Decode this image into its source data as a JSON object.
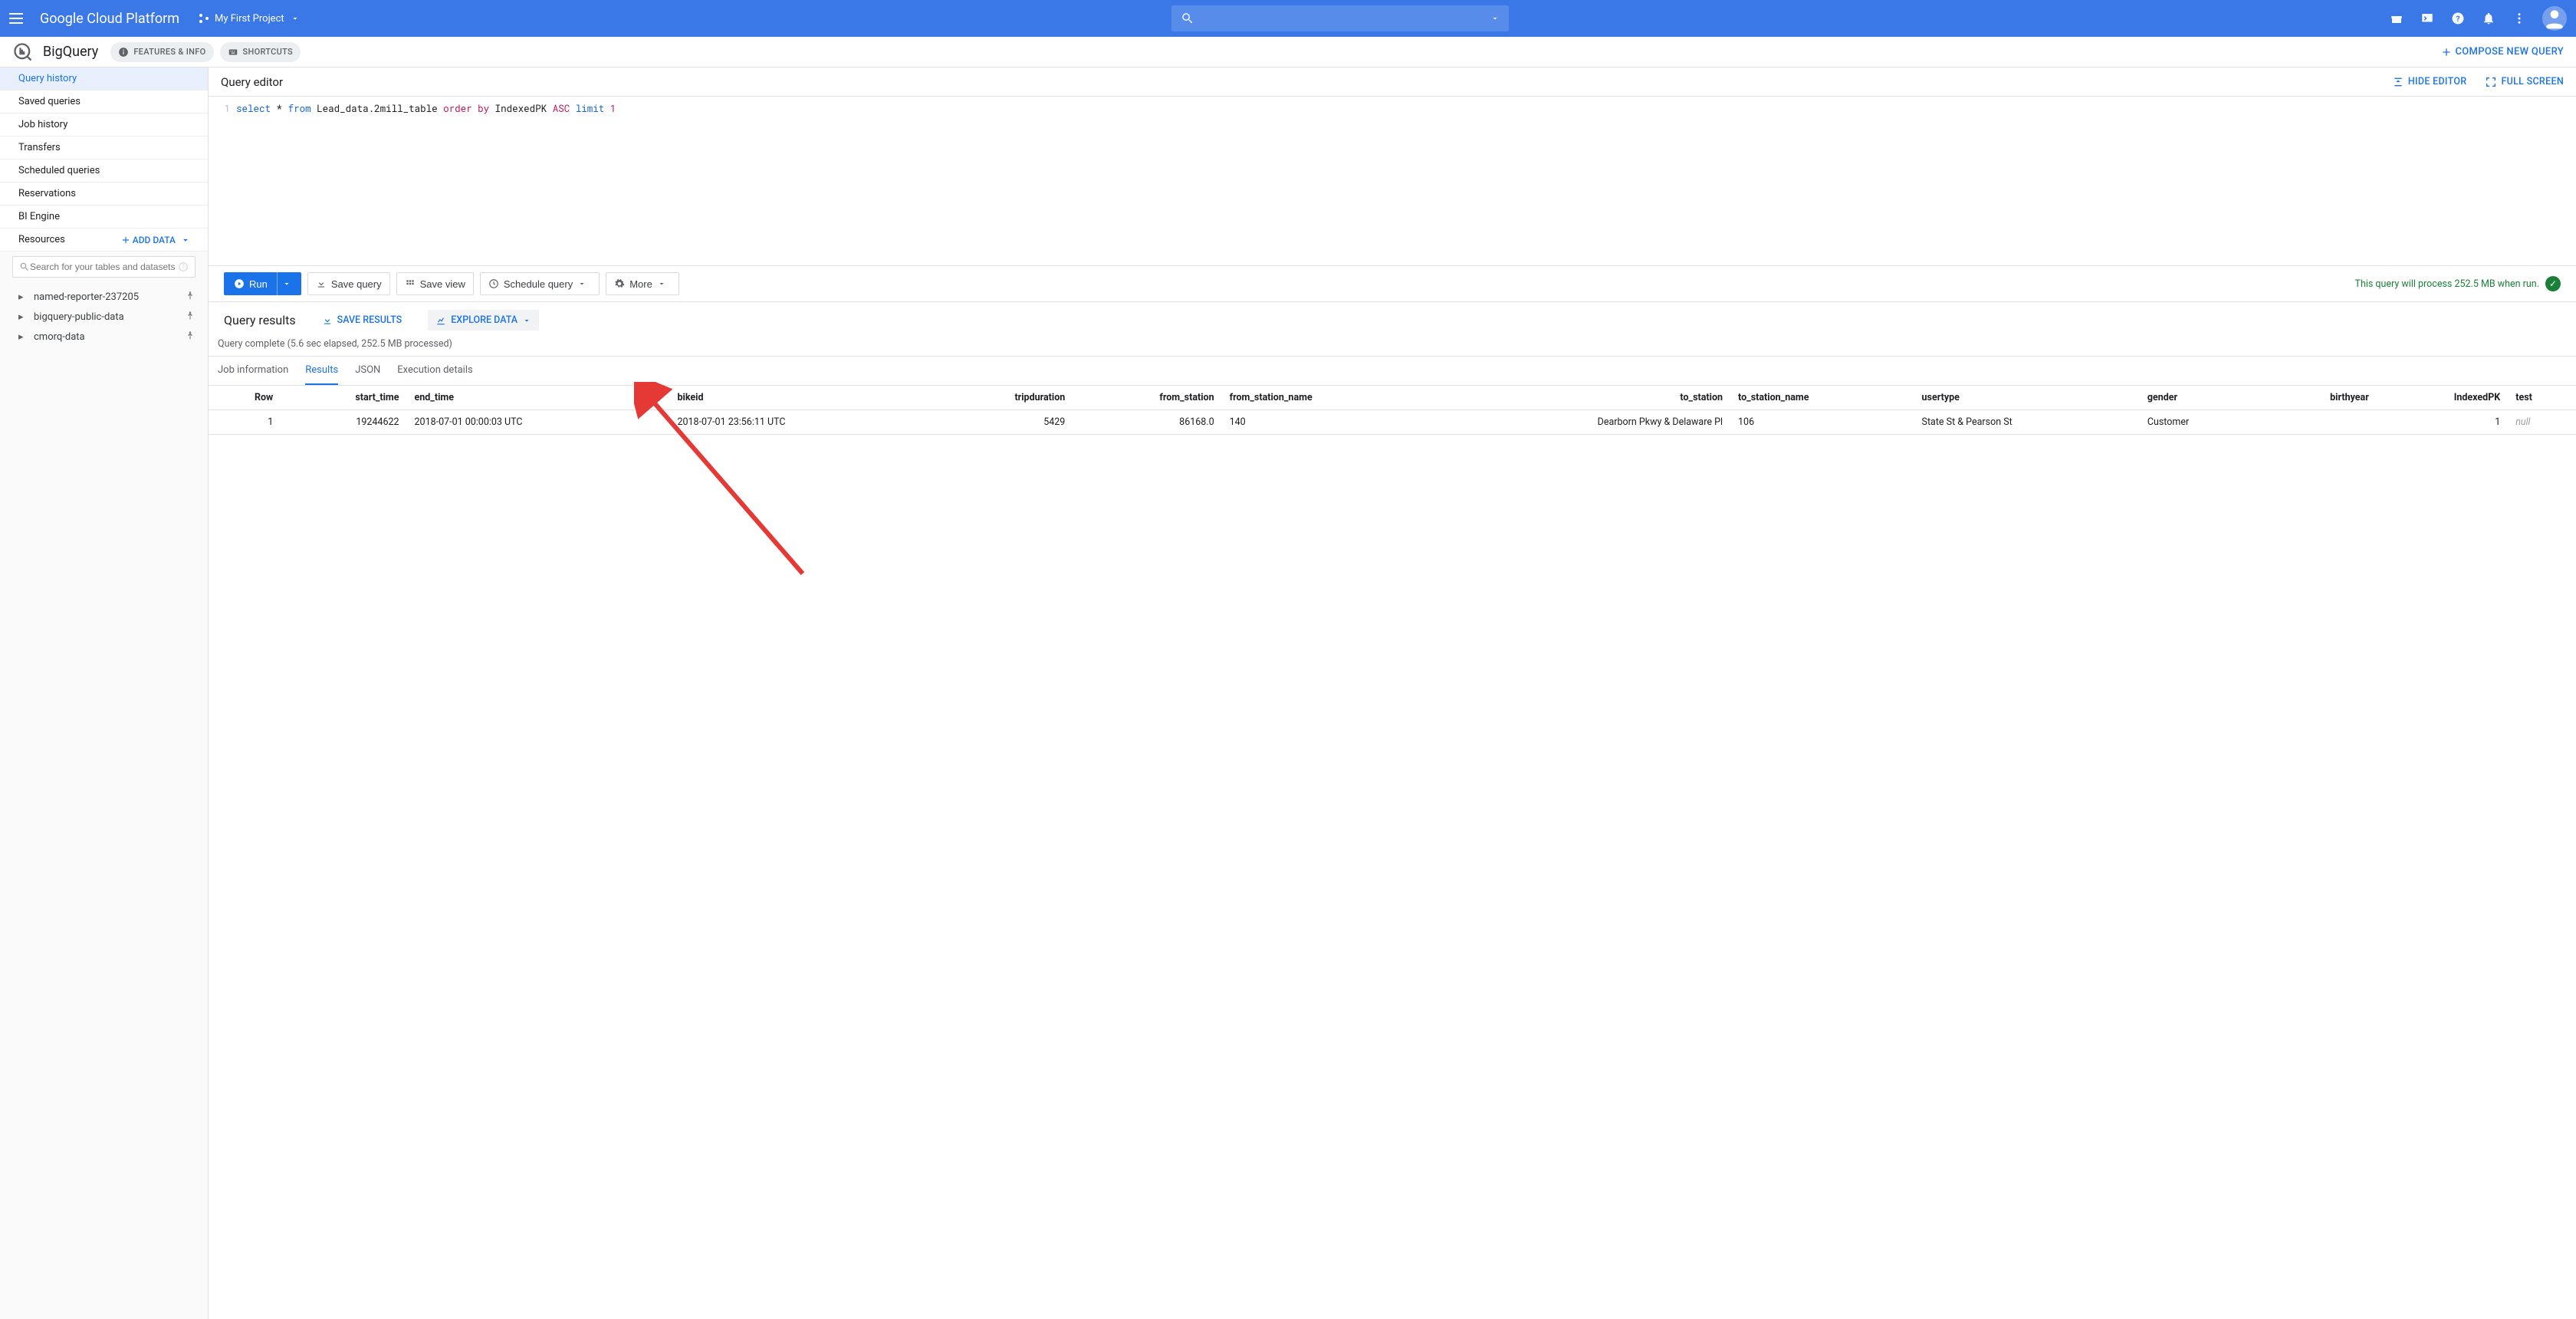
{
  "topbar": {
    "brand": "Google Cloud Platform",
    "project": "My First Project",
    "search_placeholder": ""
  },
  "subhead": {
    "product": "BigQuery",
    "features_info": "FEATURES & INFO",
    "shortcuts": "SHORTCUTS",
    "compose": "COMPOSE NEW QUERY"
  },
  "sidebar": {
    "items": [
      "Query history",
      "Saved queries",
      "Job history",
      "Transfers",
      "Scheduled queries",
      "Reservations",
      "BI Engine"
    ],
    "resources_label": "Resources",
    "add_data": "ADD DATA",
    "search_placeholder": "Search for your tables and datasets",
    "tree": [
      "named-reporter-237205",
      "bigquery-public-data",
      "cmorq-data"
    ]
  },
  "editor": {
    "title": "Query editor",
    "hide": "HIDE EDITOR",
    "full": "FULL SCREEN",
    "sql_tokens": [
      {
        "t": "kw",
        "v": "select"
      },
      {
        "t": "sp",
        "v": " "
      },
      {
        "t": "ident",
        "v": "*"
      },
      {
        "t": "sp",
        "v": " "
      },
      {
        "t": "kw",
        "v": "from"
      },
      {
        "t": "sp",
        "v": " "
      },
      {
        "t": "ident",
        "v": "Lead_data.2mill_table"
      },
      {
        "t": "sp",
        "v": " "
      },
      {
        "t": "kw2",
        "v": "order by"
      },
      {
        "t": "sp",
        "v": " "
      },
      {
        "t": "ident",
        "v": "IndexedPK"
      },
      {
        "t": "sp",
        "v": " "
      },
      {
        "t": "kw2",
        "v": "ASC"
      },
      {
        "t": "sp",
        "v": " "
      },
      {
        "t": "kw",
        "v": "limit"
      },
      {
        "t": "sp",
        "v": " "
      },
      {
        "t": "num",
        "v": "1"
      }
    ]
  },
  "toolbar": {
    "run": "Run",
    "save_query": "Save query",
    "save_view": "Save view",
    "schedule": "Schedule query",
    "more": "More",
    "validation": "This query will process 252.5 MB when run."
  },
  "results": {
    "title": "Query results",
    "save_results": "SAVE RESULTS",
    "explore": "EXPLORE DATA",
    "status": "Query complete (5.6 sec elapsed, 252.5 MB processed)",
    "tabs": [
      "Job information",
      "Results",
      "JSON",
      "Execution details"
    ],
    "columns": [
      "Row",
      "start_time",
      "end_time",
      "bikeid",
      "tripduration",
      "from_station",
      "from_station_name",
      "to_station",
      "to_station_name",
      "usertype",
      "gender",
      "birthyear",
      "IndexedPK",
      "test"
    ],
    "numeric_cols": [
      "Row",
      "start_time",
      "tripduration",
      "from_station",
      "to_station",
      "birthyear",
      "IndexedPK"
    ],
    "rows": [
      {
        "Row": "1",
        "start_time": "19244622",
        "end_time": "2018-07-01 00:00:03 UTC",
        "bikeid": "2018-07-01 23:56:11 UTC",
        "tripduration": "5429",
        "from_station": "86168.0",
        "from_station_name": "140",
        "to_station": "Dearborn Pkwy & Delaware Pl",
        "to_station_name": "106",
        "usertype": "State St & Pearson St",
        "gender": "Customer",
        "birthyear": "",
        "IndexedPK": "1",
        "test": "null"
      }
    ]
  }
}
